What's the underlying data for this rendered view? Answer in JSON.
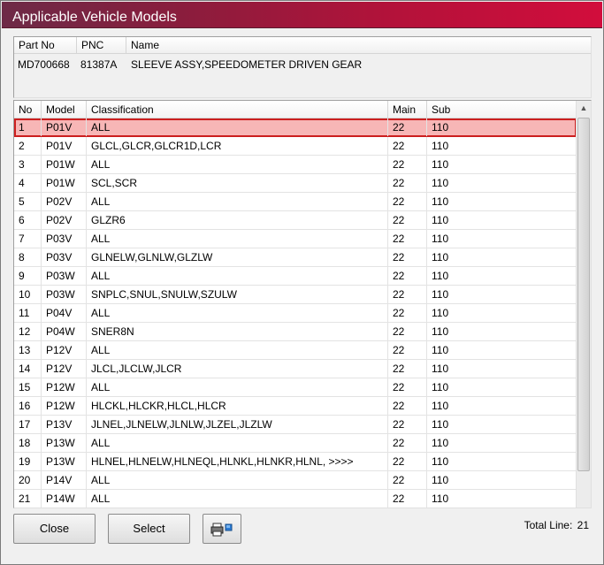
{
  "window": {
    "title": "Applicable Vehicle Models"
  },
  "part": {
    "headers": {
      "part_no": "Part No",
      "pnc": "PNC",
      "name": "Name"
    },
    "values": {
      "part_no": "MD700668",
      "pnc": "81387A",
      "name": "SLEEVE ASSY,SPEEDOMETER DRIVEN GEAR"
    }
  },
  "grid": {
    "headers": {
      "no": "No",
      "model": "Model",
      "classification": "Classification",
      "main": "Main",
      "sub": "Sub"
    },
    "rows": [
      {
        "no": "1",
        "model": "P01V",
        "classification": "ALL",
        "main": "22",
        "sub": "110"
      },
      {
        "no": "2",
        "model": "P01V",
        "classification": "GLCL,GLCR,GLCR1D,LCR",
        "main": "22",
        "sub": "110"
      },
      {
        "no": "3",
        "model": "P01W",
        "classification": "ALL",
        "main": "22",
        "sub": "110"
      },
      {
        "no": "4",
        "model": "P01W",
        "classification": "SCL,SCR",
        "main": "22",
        "sub": "110"
      },
      {
        "no": "5",
        "model": "P02V",
        "classification": "ALL",
        "main": "22",
        "sub": "110"
      },
      {
        "no": "6",
        "model": "P02V",
        "classification": "GLZR6",
        "main": "22",
        "sub": "110"
      },
      {
        "no": "7",
        "model": "P03V",
        "classification": "ALL",
        "main": "22",
        "sub": "110"
      },
      {
        "no": "8",
        "model": "P03V",
        "classification": "GLNELW,GLNLW,GLZLW",
        "main": "22",
        "sub": "110"
      },
      {
        "no": "9",
        "model": "P03W",
        "classification": "ALL",
        "main": "22",
        "sub": "110"
      },
      {
        "no": "10",
        "model": "P03W",
        "classification": "SNPLC,SNUL,SNULW,SZULW",
        "main": "22",
        "sub": "110"
      },
      {
        "no": "11",
        "model": "P04V",
        "classification": "ALL",
        "main": "22",
        "sub": "110"
      },
      {
        "no": "12",
        "model": "P04W",
        "classification": "SNER8N",
        "main": "22",
        "sub": "110"
      },
      {
        "no": "13",
        "model": "P12V",
        "classification": "ALL",
        "main": "22",
        "sub": "110"
      },
      {
        "no": "14",
        "model": "P12V",
        "classification": "JLCL,JLCLW,JLCR",
        "main": "22",
        "sub": "110"
      },
      {
        "no": "15",
        "model": "P12W",
        "classification": "ALL",
        "main": "22",
        "sub": "110"
      },
      {
        "no": "16",
        "model": "P12W",
        "classification": "HLCKL,HLCKR,HLCL,HLCR",
        "main": "22",
        "sub": "110"
      },
      {
        "no": "17",
        "model": "P13V",
        "classification": "JLNEL,JLNELW,JLNLW,JLZEL,JLZLW",
        "main": "22",
        "sub": "110"
      },
      {
        "no": "18",
        "model": "P13W",
        "classification": "ALL",
        "main": "22",
        "sub": "110"
      },
      {
        "no": "19",
        "model": "P13W",
        "classification": "HLNEL,HLNELW,HLNEQL,HLNKL,HLNKR,HLNL,   >>>>",
        "main": "22",
        "sub": "110"
      },
      {
        "no": "20",
        "model": "P14V",
        "classification": "ALL",
        "main": "22",
        "sub": "110"
      },
      {
        "no": "21",
        "model": "P14W",
        "classification": "ALL",
        "main": "22",
        "sub": "110"
      }
    ],
    "selected_index": 0
  },
  "buttons": {
    "close": "Close",
    "select": "Select",
    "print_icon": "printer-icon"
  },
  "footer": {
    "total_label": "Total Line:",
    "total_value": "21"
  },
  "colors": {
    "title_start": "#6d2a47",
    "title_end": "#d20d3c",
    "selection_fill": "#f7b6b6",
    "selection_border": "#cc1f1f"
  }
}
